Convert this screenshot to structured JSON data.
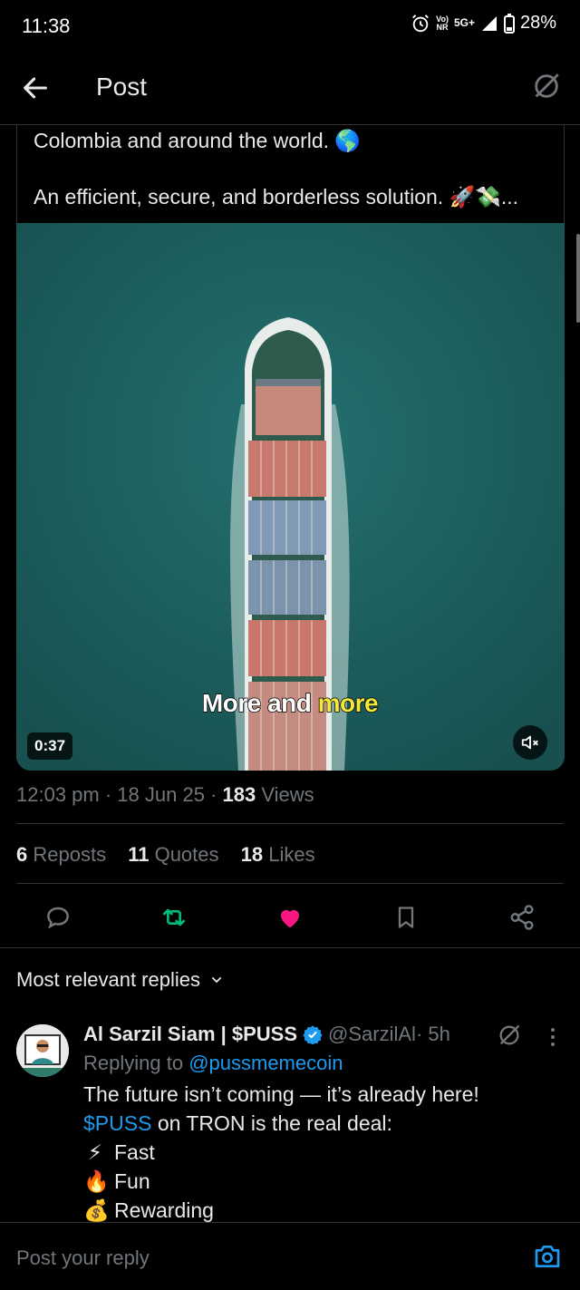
{
  "status_bar": {
    "time": "11:38",
    "network_top": "Vo)",
    "network_bottom": "NR",
    "signal": "5G+",
    "battery": "28%"
  },
  "header": {
    "title": "Post",
    "back_icon": "arrow-left-icon",
    "grok_icon": "grok-icon"
  },
  "tweet": {
    "text_line_1": "Colombia and around the world. 🌎",
    "text_line_2": "An efficient, secure, and borderless solution. 🚀💸..."
  },
  "video": {
    "caption_white": "More and ",
    "caption_yellow": "more",
    "duration": "0:37",
    "mute_icon": "speaker-muted-icon"
  },
  "meta": {
    "time": "12:03 pm",
    "separator": " · ",
    "date": "18 Jun 25",
    "views_count": "183",
    "views_label": " Views"
  },
  "stats": [
    {
      "count": "6",
      "label": " Reposts"
    },
    {
      "count": "11",
      "label": " Quotes"
    },
    {
      "count": "18",
      "label": " Likes"
    }
  ],
  "actions": {
    "reply_icon": "reply-icon",
    "repost_icon": "repost-icon",
    "like_icon": "heart-filled-icon",
    "bookmark_icon": "bookmark-icon",
    "share_icon": "share-icon",
    "colors": {
      "repost": "#00ba7c",
      "like": "#f91880",
      "default": "#71767b"
    }
  },
  "replies": {
    "sort_label": "Most relevant replies",
    "items": [
      {
        "name": "Al Sarzil Siam | $PUSS",
        "handle": "@SarzilAl",
        "time": " · 5h",
        "replying_prefix": "Replying to ",
        "replying_to": "@pussmemecoin",
        "line_1": "The future isn’t coming — it’s already here!",
        "line_2_link": "$PUSS",
        "line_2_rest": " on TRON is the real deal:",
        "bullets": [
          {
            "emoji": "⚡",
            "text": "Fast"
          },
          {
            "emoji": "🔥",
            "text": "Fun"
          },
          {
            "emoji": "💰",
            "text": "Rewarding"
          }
        ]
      }
    ]
  },
  "compose": {
    "placeholder": "Post your reply",
    "camera_icon": "camera-icon"
  },
  "colors": {
    "background": "#000000",
    "text": "#e7e9ea",
    "muted": "#71767b",
    "link": "#1d9bf0",
    "border": "#2f3336",
    "verified": "#1d9bf0"
  }
}
